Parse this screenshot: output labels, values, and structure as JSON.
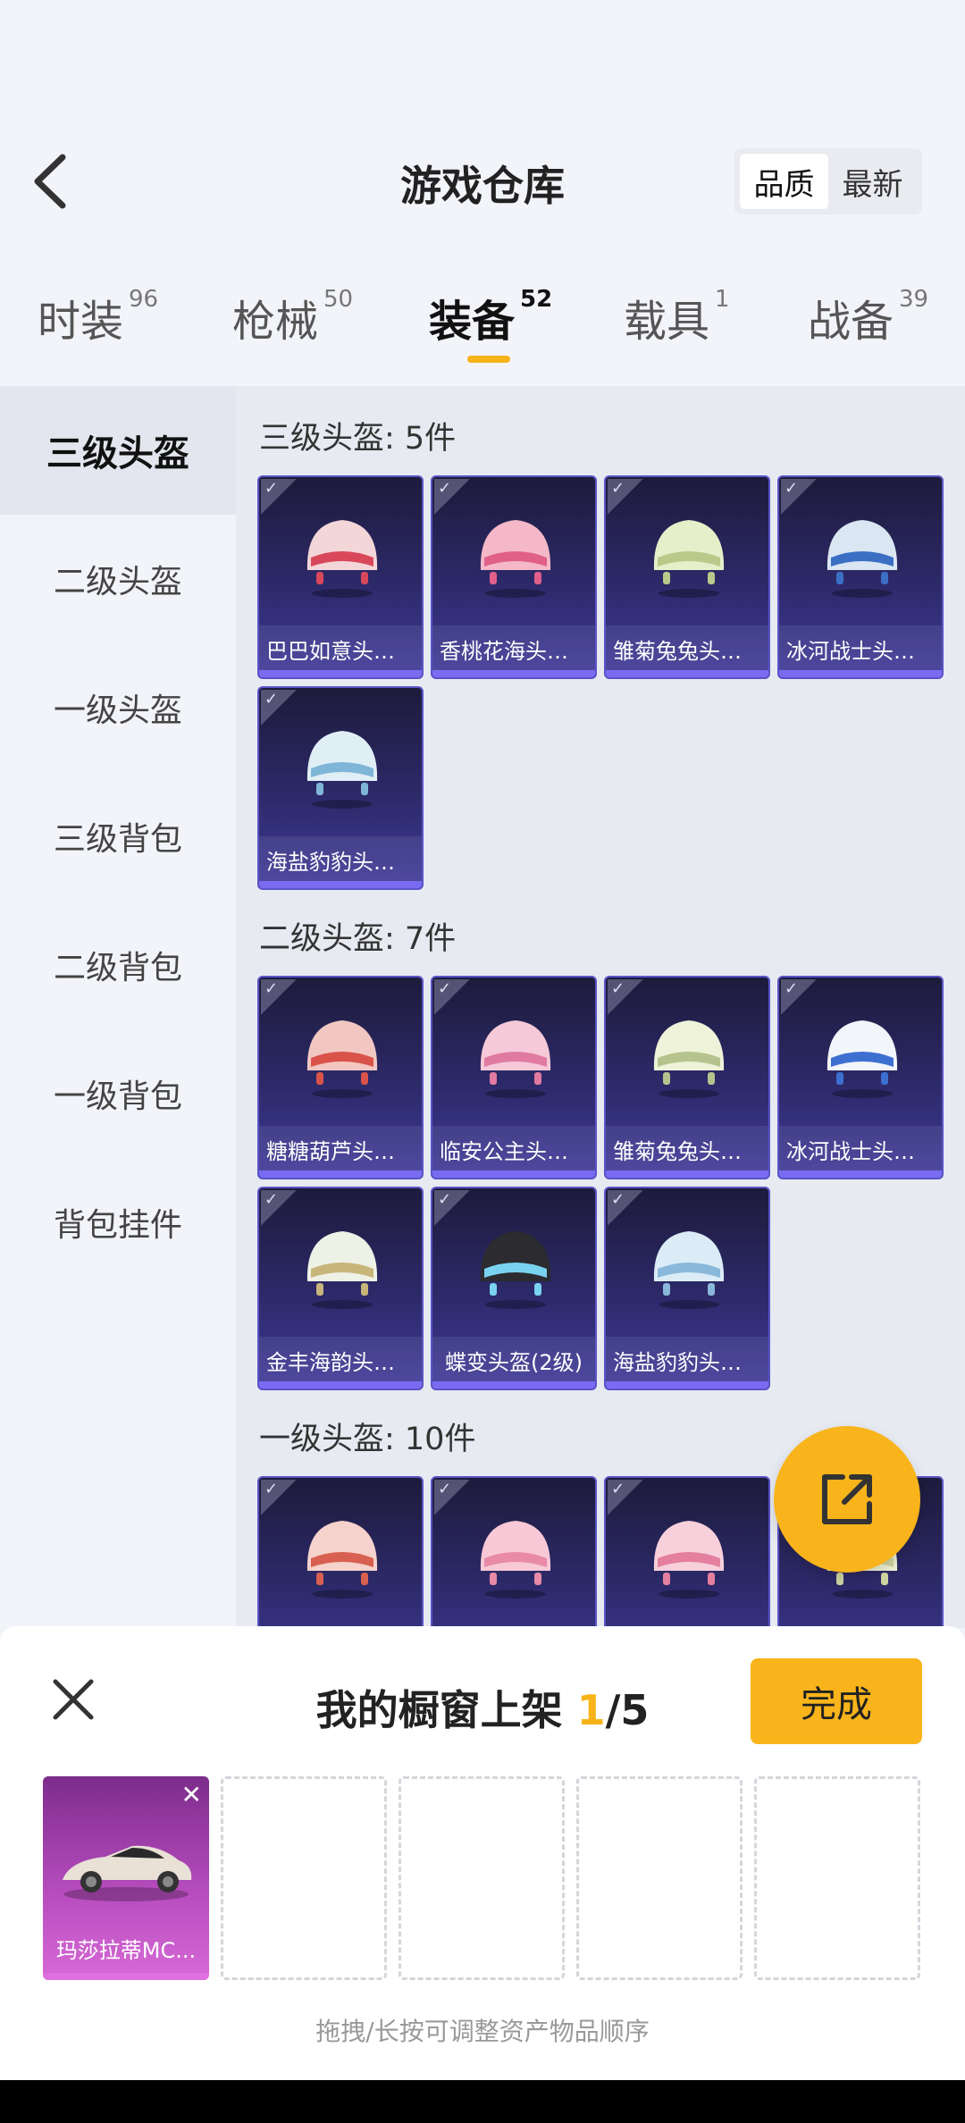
{
  "header": {
    "title": "游戏仓库",
    "sort": {
      "options": [
        "品质",
        "最新"
      ],
      "active": 0
    }
  },
  "tabs": [
    {
      "label": "时装",
      "count": "96"
    },
    {
      "label": "枪械",
      "count": "50"
    },
    {
      "label": "装备",
      "count": "52",
      "active": true
    },
    {
      "label": "载具",
      "count": "1"
    },
    {
      "label": "战备",
      "count": "39"
    }
  ],
  "sidebar": {
    "items": [
      "三级头盔",
      "二级头盔",
      "一级头盔",
      "三级背包",
      "二级背包",
      "一级背包",
      "背包挂件"
    ],
    "active": 0
  },
  "sections": [
    {
      "title": "三级头盔: 5件",
      "items": [
        "巴巴如意头盔...",
        "香桃花海头盔...",
        "雏菊兔兔头盔...",
        "冰河战士头盔...",
        "海盐豹豹头盔..."
      ]
    },
    {
      "title": "二级头盔: 7件",
      "items": [
        "糖糖葫芦头盔...",
        "临安公主头盔...",
        "雏菊兔兔头盔...",
        "冰河战士头盔...",
        "金丰海韵头盔...",
        "蝶变头盔(2级)",
        "海盐豹豹头盔..."
      ]
    },
    {
      "title": "一级头盔: 10件",
      "items": [
        "",
        "",
        "",
        ""
      ]
    }
  ],
  "showcase": {
    "title_prefix": "我的橱窗上架 ",
    "current": "1",
    "total": "/5",
    "done_label": "完成",
    "slots": [
      {
        "name": "玛莎拉蒂MC..."
      },
      null,
      null,
      null,
      null
    ],
    "hint": "拖拽/长按可调整资产物品顺序"
  },
  "colors": {
    "accent": "#f8b41a",
    "card_bg": "#2d2a6b",
    "card_stripe": "#7a6cf2",
    "vehicle_card": "#b94ec0"
  },
  "icons": [
    "back-arrow-icon",
    "share-icon",
    "close-icon",
    "check-icon",
    "remove-icon"
  ]
}
